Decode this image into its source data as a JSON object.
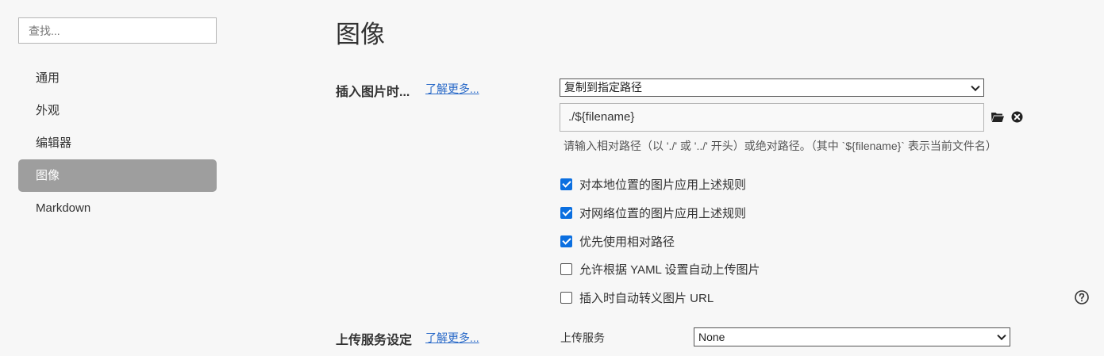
{
  "sidebar": {
    "search_placeholder": "查找...",
    "items": [
      {
        "label": "通用"
      },
      {
        "label": "外观"
      },
      {
        "label": "编辑器"
      },
      {
        "label": "图像"
      },
      {
        "label": "Markdown"
      }
    ],
    "active_index": 3
  },
  "main": {
    "title": "图像",
    "insert_section": {
      "label": "插入图片时...",
      "learn_more": "了解更多...",
      "action_selected": "复制到指定路径",
      "path_value": "./${filename}",
      "hint": "请输入相对路径（以 './' 或 '../' 开头）或绝对路径。（其中 `${filename}` 表示当前文件名）",
      "options": [
        {
          "label": "对本地位置的图片应用上述规则",
          "checked": true
        },
        {
          "label": "对网络位置的图片应用上述规则",
          "checked": true
        },
        {
          "label": "优先使用相对路径",
          "checked": true
        },
        {
          "label": "允许根据 YAML 设置自动上传图片",
          "checked": false
        },
        {
          "label": "插入时自动转义图片 URL",
          "checked": false
        }
      ]
    },
    "upload_section": {
      "label": "上传服务设定",
      "learn_more": "了解更多...",
      "service_label": "上传服务",
      "service_selected": "None"
    }
  },
  "icons": {
    "folder": "folder-icon",
    "clear": "clear-icon",
    "help": "help-icon",
    "checkbox_color": "#0b6fe0",
    "active_nav_color": "#9e9e9e",
    "link_color": "#2a6ac8"
  }
}
